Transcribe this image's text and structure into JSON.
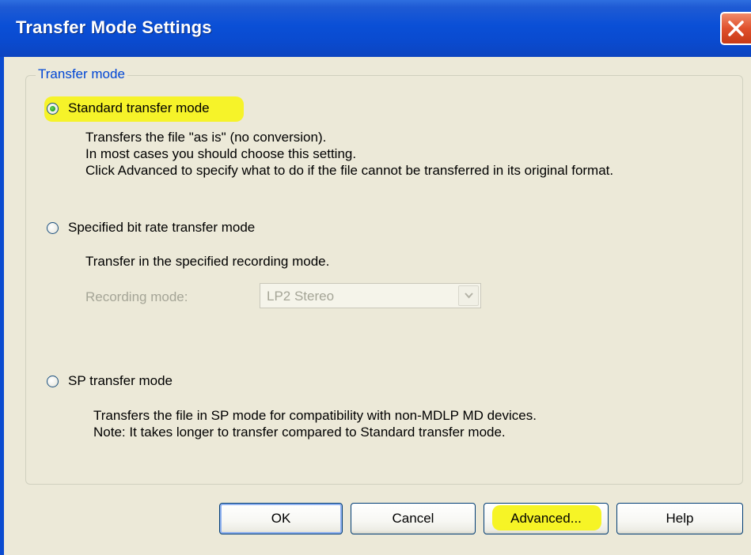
{
  "window": {
    "title": "Transfer Mode Settings",
    "close_icon": "close-x-icon"
  },
  "group": {
    "legend": "Transfer mode"
  },
  "options": [
    {
      "label": "Standard transfer mode",
      "selected": true,
      "description": [
        "Transfers the file \"as is\" (no conversion).",
        "In most cases you should choose this setting.",
        "Click Advanced to specify what to do if the file cannot be transferred in its original format."
      ]
    },
    {
      "label": "Specified bit rate transfer mode",
      "selected": false,
      "description": [
        "Transfer in the specified recording mode."
      ],
      "recording_mode": {
        "label": "Recording mode:",
        "value": "LP2 Stereo",
        "enabled": false
      }
    },
    {
      "label": "SP transfer mode",
      "selected": false,
      "description": [
        "Transfers the file in SP mode for compatibility with non-MDLP MD devices.",
        "Note: It takes longer to transfer compared to Standard transfer mode."
      ]
    }
  ],
  "buttons": {
    "ok": "OK",
    "cancel": "Cancel",
    "advanced": "Advanced...",
    "help": "Help"
  },
  "colors": {
    "title_bar": "#0a4bd0",
    "legend_text": "#0046d5",
    "highlight": "#f6f31a",
    "disabled_text": "#a5a597"
  }
}
